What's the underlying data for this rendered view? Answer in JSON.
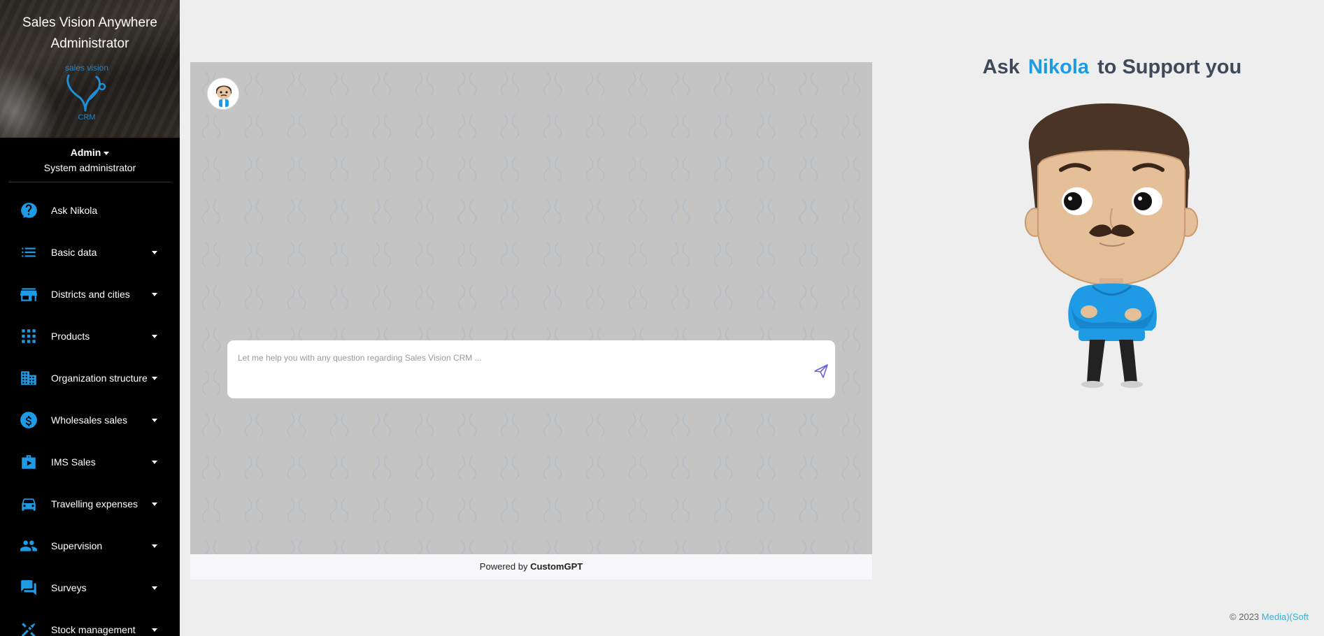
{
  "sidebar": {
    "app_title_line1": "Sales Vision Anywhere",
    "app_title_line2": "Administrator",
    "logo": {
      "top": "sales vision",
      "bottom": "CRM"
    },
    "user": {
      "name": "Admin",
      "role": "System administrator"
    },
    "items": [
      {
        "label": "Ask Nikola",
        "icon": "help-circle-icon",
        "has_submenu": false
      },
      {
        "label": "Basic data",
        "icon": "list-icon",
        "has_submenu": true
      },
      {
        "label": "Districts and cities",
        "icon": "store-icon",
        "has_submenu": true
      },
      {
        "label": "Products",
        "icon": "apps-grid-icon",
        "has_submenu": true
      },
      {
        "label": "Organization structure",
        "icon": "building-icon",
        "has_submenu": true
      },
      {
        "label": "Wholesales sales",
        "icon": "dollar-circle-icon",
        "has_submenu": true
      },
      {
        "label": "IMS Sales",
        "icon": "briefcase-icon",
        "has_submenu": true
      },
      {
        "label": "Travelling expenses",
        "icon": "car-icon",
        "has_submenu": true
      },
      {
        "label": "Supervision",
        "icon": "people-icon",
        "has_submenu": true
      },
      {
        "label": "Surveys",
        "icon": "chat-bubbles-icon",
        "has_submenu": true
      },
      {
        "label": "Stock management",
        "icon": "tools-icon",
        "has_submenu": true
      }
    ]
  },
  "chat": {
    "placeholder": "Let me help you with any question regarding Sales Vision CRM ...",
    "powered_prefix": "Powered by",
    "powered_brand": "CustomGPT"
  },
  "heading": {
    "prefix": "Ask",
    "name": "Nikola",
    "suffix": "to Support you"
  },
  "footer": {
    "copyright": "© 2023",
    "brand": "Media)(Soft"
  },
  "colors": {
    "accent": "#1e9be4",
    "sidebar_bg": "#000000",
    "page_bg": "#eeeeee",
    "chat_bg": "#c4c4c4"
  }
}
